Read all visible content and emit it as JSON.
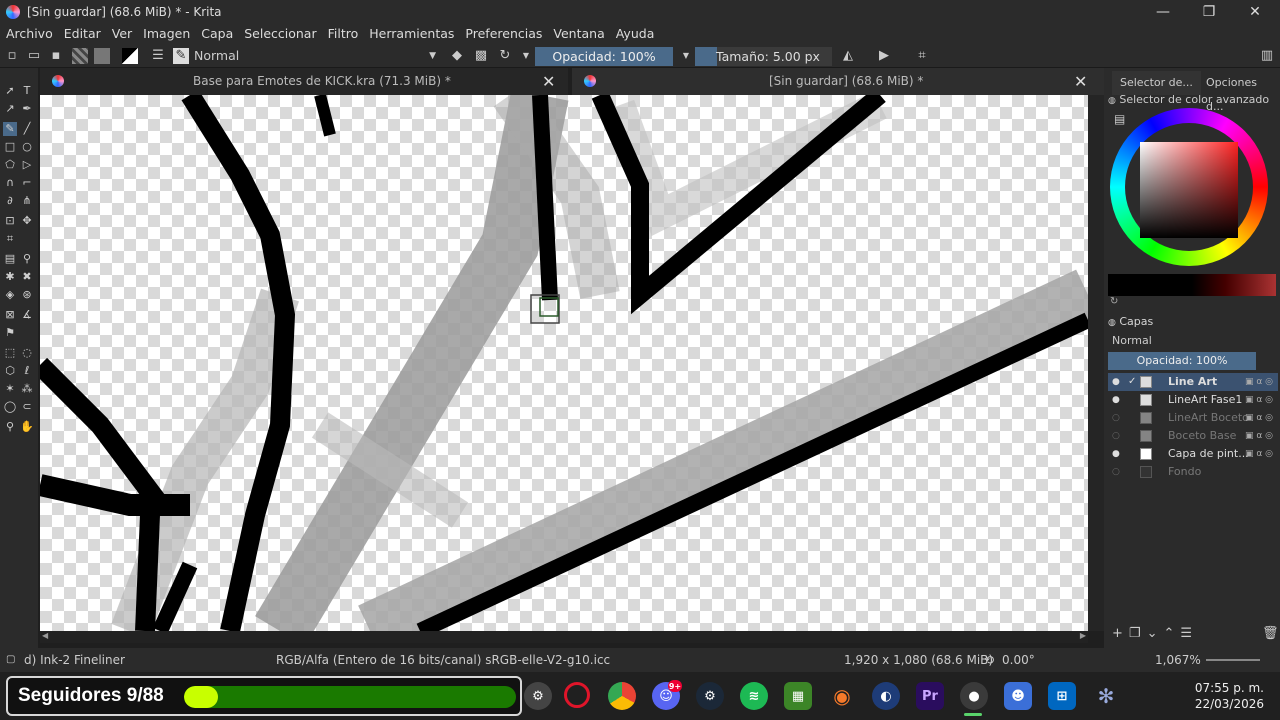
{
  "window": {
    "title": "[Sin guardar]  (68.6 MiB) * - Krita",
    "minimize": "—",
    "maximize": "❐",
    "close": "✕"
  },
  "menu": [
    "Archivo",
    "Editar",
    "Ver",
    "Imagen",
    "Capa",
    "Seleccionar",
    "Filtro",
    "Herramientas",
    "Preferencias",
    "Ventana",
    "Ayuda"
  ],
  "toolbar": {
    "blend_mode": "Normal",
    "opacity_label": "Opacidad: 100%",
    "size_label": "Tamaño: 5.00 px",
    "size_value": 0.16
  },
  "tabs": [
    {
      "label": "Base para Emotes de KICK.kra (71.3 MiB) *"
    },
    {
      "label": "[Sin guardar]  (68.6 MiB) *"
    }
  ],
  "dockers": {
    "tab1": "Selector de...",
    "tab2": "Opciones d...",
    "color_title": "Selector de color avanzado",
    "layers_title": "Capas",
    "layer_blend": "Normal",
    "layer_opacity": "Opacidad:  100%"
  },
  "layers": [
    {
      "name": "Line Art",
      "visible": true,
      "selected": true
    },
    {
      "name": "LineArt Fase1",
      "visible": true,
      "selected": false
    },
    {
      "name": "LineArt Boceto",
      "visible": false,
      "selected": false
    },
    {
      "name": "Boceto Base",
      "visible": false,
      "selected": false
    },
    {
      "name": "Capa de pint...",
      "visible": true,
      "selected": false
    },
    {
      "name": "Fondo",
      "visible": false,
      "selected": false
    }
  ],
  "status": {
    "brush": "d) Ink-2 Fineliner",
    "color_space": "RGB/Alfa (Entero de 16 bits/canal)  sRGB-elle-V2-g10.icc",
    "dimensions": "1,920 x 1,080 (68.6 MiB)",
    "rotation": "0.00°",
    "zoom": "1,067%"
  },
  "overlay": {
    "followers_label": "Seguidores 9/88",
    "followers_current": 9,
    "followers_goal": 88,
    "followers_fraction": 0.102
  },
  "taskbar": {
    "apps": [
      "krita-ball-icon",
      "opera-icon",
      "chrome-icon",
      "discord-icon",
      "steam-icon",
      "spotify-icon",
      "minecraft-icon",
      "blender-icon",
      "cinema4d-icon",
      "premiere-icon",
      "krita-icon",
      "bot-icon",
      "store-icon",
      "settings-icon"
    ],
    "premiere_label": "Pr",
    "discord_badge": "9+",
    "time": "07:55 p. m.",
    "date": "22/03/2026"
  },
  "colors": {
    "accent": "#4a6a8a",
    "progress_fill": "#c8ff00",
    "progress_track": "#1a7a00"
  }
}
